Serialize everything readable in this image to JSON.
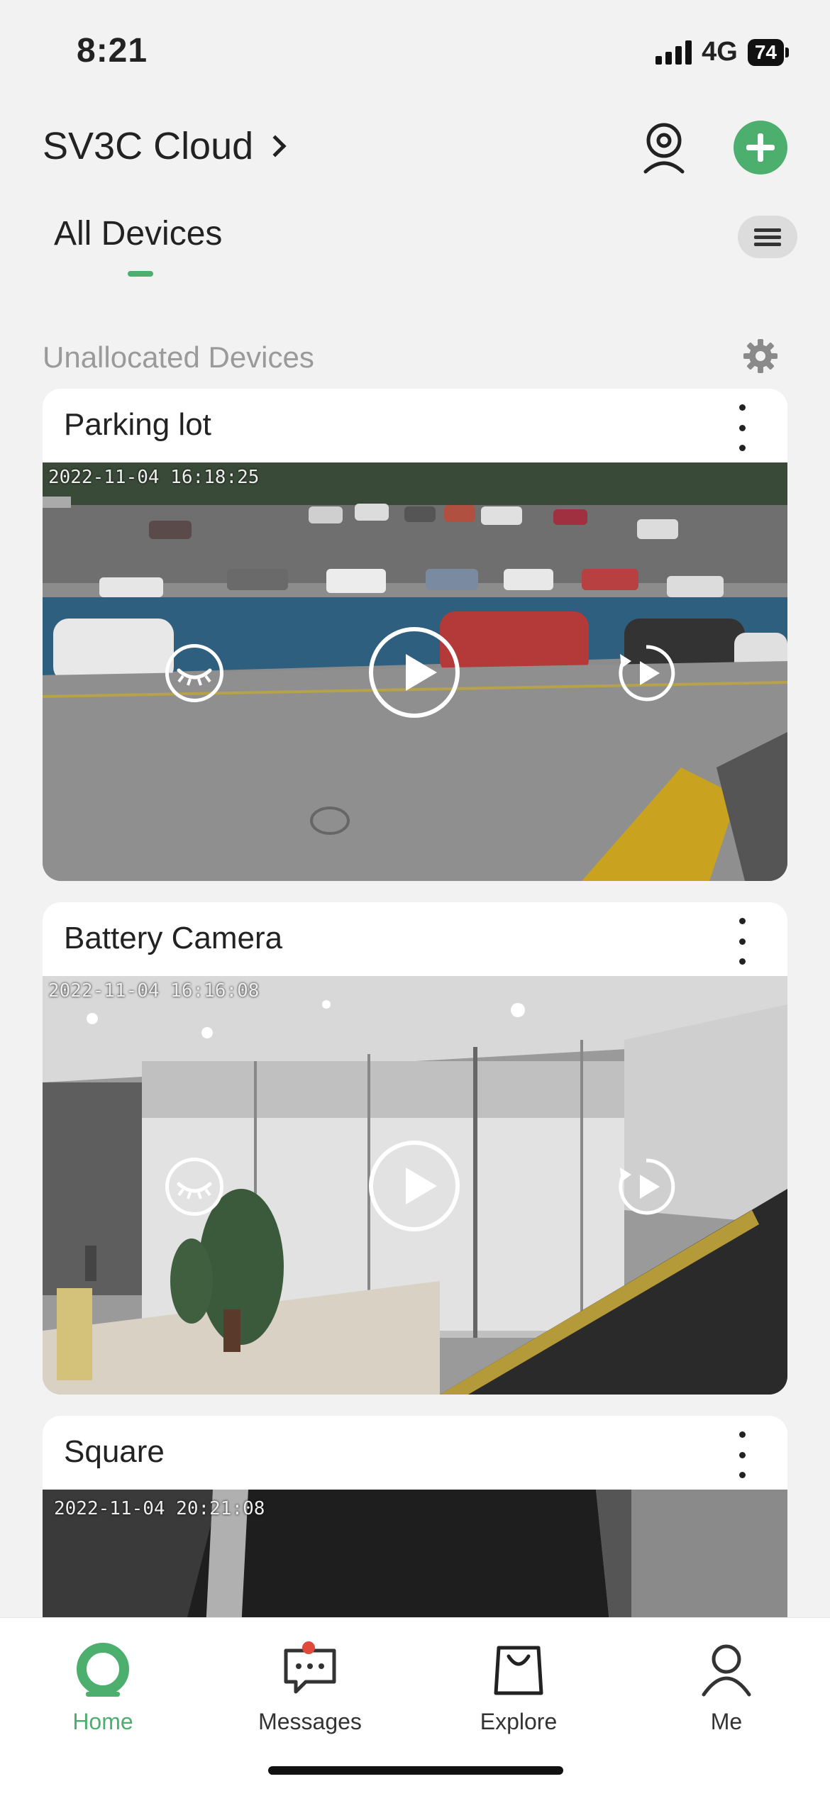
{
  "status_bar": {
    "time": "8:21",
    "network": "4G",
    "battery": "74"
  },
  "header": {
    "title": "SV3C Cloud",
    "tab_all_devices": "All Devices"
  },
  "section": {
    "title": "Unallocated Devices"
  },
  "devices": [
    {
      "name": "Parking lot",
      "timestamp": "2022-11-04 16:18:25"
    },
    {
      "name": "Battery Camera",
      "timestamp": "2022-11-04 16:16:08"
    },
    {
      "name": "Square",
      "timestamp": "2022-11-04 20:21:08"
    }
  ],
  "tabbar": {
    "items": [
      {
        "label": "Home",
        "icon": "home-icon",
        "active": true
      },
      {
        "label": "Messages",
        "icon": "messages-icon",
        "active": false
      },
      {
        "label": "Explore",
        "icon": "explore-icon",
        "active": false
      },
      {
        "label": "Me",
        "icon": "me-icon",
        "active": false
      }
    ]
  },
  "colors": {
    "accent": "#4caf6d",
    "badge": "#e04a3a",
    "background": "#f2f2f2"
  }
}
